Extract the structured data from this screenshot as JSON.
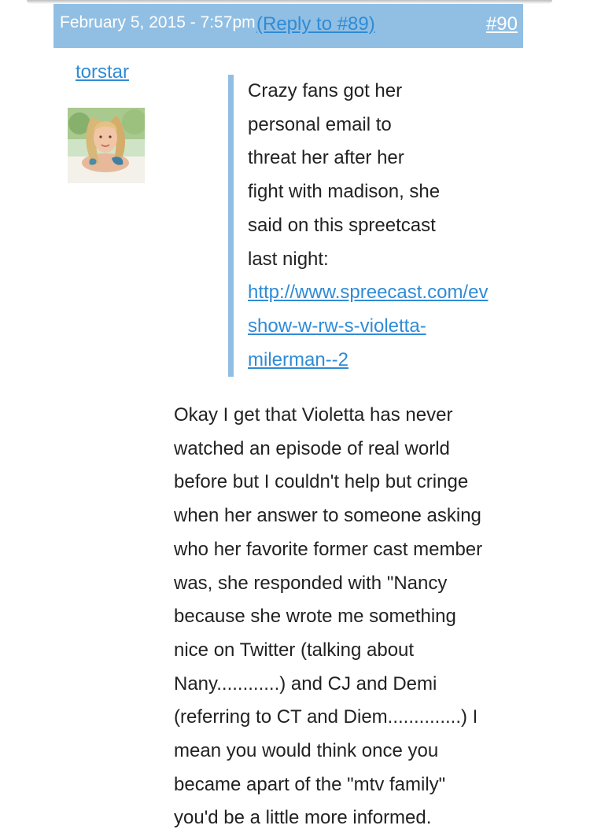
{
  "post": {
    "date": "February 5, 2015 - 7:57pm",
    "reply_link": "(Reply to #89)",
    "number": "#90"
  },
  "author": {
    "name": "torstar"
  },
  "quote": {
    "lines": [
      "Crazy fans got her",
      "personal email to",
      "threat her after her",
      "fight with madison, she",
      "said on this spreetcast",
      "last night:"
    ],
    "link_lines": [
      "http://www.spreecast.com/ev",
      "show-w-rw-s-violetta-",
      "milerman--2"
    ]
  },
  "body": {
    "lines": [
      "Okay I get that Violetta has never",
      "watched an episode of real world",
      "before but I couldn't help but cringe",
      "when her answer to someone asking",
      "who her favorite former cast member",
      "was, she responded with \"Nancy",
      "because she wrote me something",
      "nice on Twitter (talking about",
      "Nany............) and CJ and Demi",
      "(referring to CT and Diem..............) I",
      "mean you would think once you",
      "became apart of the \"mtv family\"",
      "you'd be a little more informed."
    ]
  },
  "colors": {
    "header_bg": "#91bfe3",
    "link": "#2f8bd6",
    "quote_bar": "#91bfe3",
    "text": "#222222"
  }
}
